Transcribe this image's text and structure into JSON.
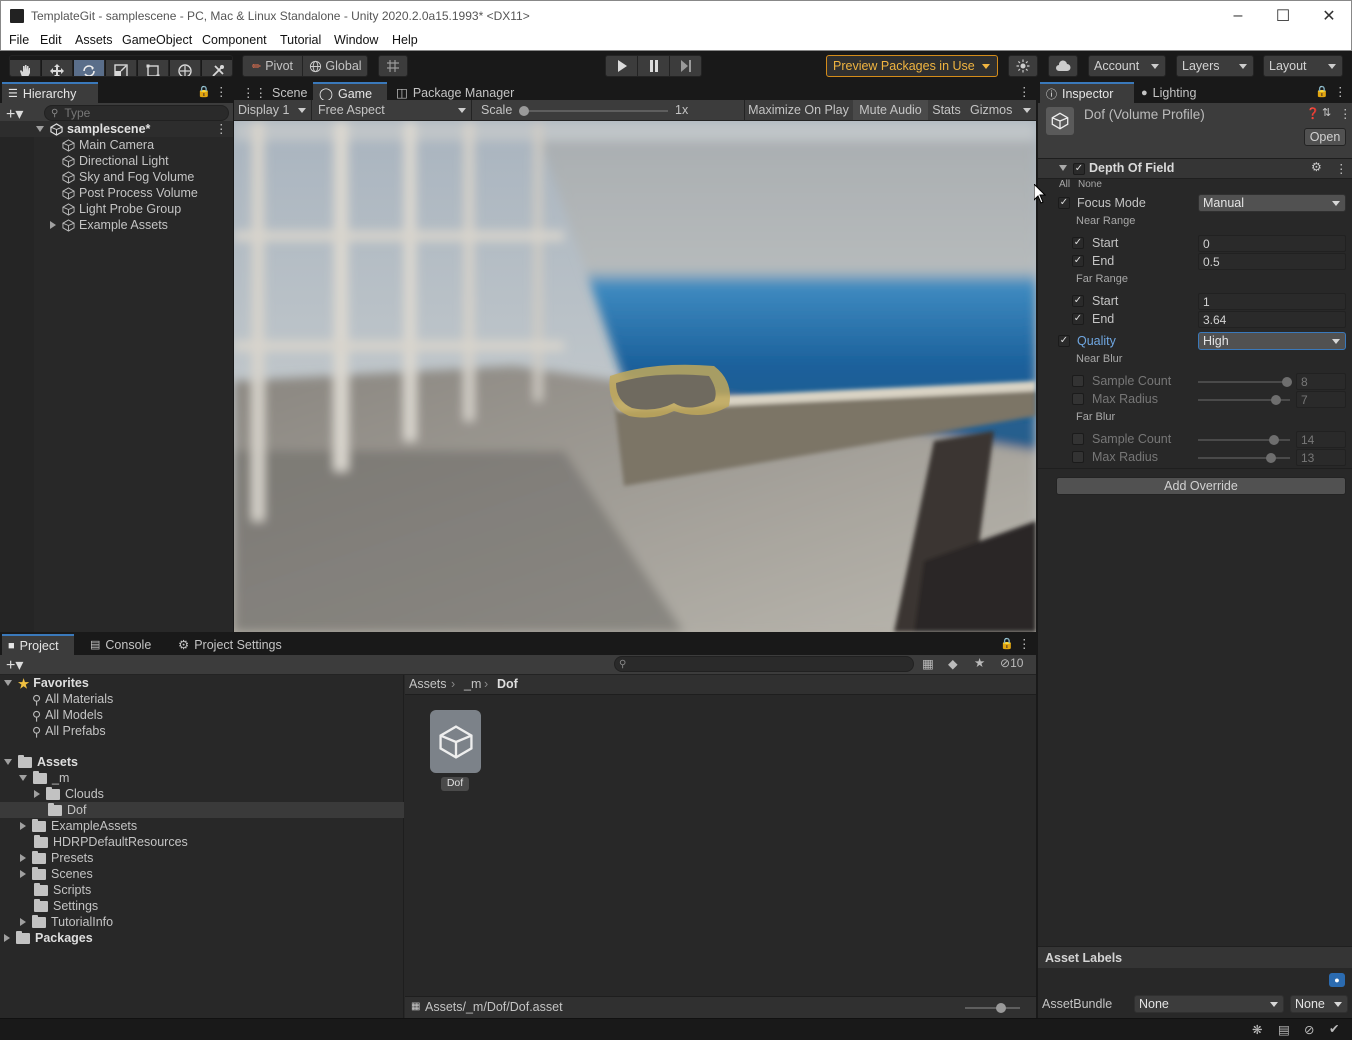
{
  "window": {
    "title": "TemplateGit - samplescene - PC, Mac & Linux Standalone - Unity 2020.2.0a15.1993* <DX11>"
  },
  "menu": [
    "File",
    "Edit",
    "Assets",
    "GameObject",
    "Component",
    "Tutorial",
    "Window",
    "Help"
  ],
  "toolbar": {
    "pivot_label": "Pivot",
    "global_label": "Global",
    "preview_packages": "Preview Packages in Use",
    "account": "Account",
    "layers": "Layers",
    "layout": "Layout"
  },
  "hierarchy": {
    "tab": "Hierarchy",
    "search_placeholder": "Type",
    "scene": "samplescene*",
    "items": [
      "Main Camera",
      "Directional Light",
      "Sky and Fog Volume",
      "Post Process Volume",
      "Light Probe Group",
      "Example Assets"
    ]
  },
  "center_tabs": {
    "scene": "Scene",
    "game": "Game",
    "package_manager": "Package Manager"
  },
  "game_bar": {
    "display": "Display 1",
    "aspect": "Free Aspect",
    "scale_label": "Scale",
    "scale_value": "1x",
    "scale_level": 0,
    "maximize": "Maximize On Play",
    "mute": "Mute Audio",
    "stats": "Stats",
    "gizmos": "Gizmos"
  },
  "inspector": {
    "tab": "Inspector",
    "lighting_tab": "Lighting",
    "asset_name": "Dof (Volume Profile)",
    "open_button": "Open",
    "component": "Depth Of Field",
    "all": "All",
    "none": "None",
    "focus_mode_label": "Focus Mode",
    "focus_mode_value": "Manual",
    "near_range": "Near Range",
    "near_start_label": "Start",
    "near_start": "0",
    "near_end_label": "End",
    "near_end": "0.5",
    "far_range": "Far Range",
    "far_start_label": "Start",
    "far_start": "1",
    "far_end_label": "End",
    "far_end": "3.64",
    "quality_label": "Quality",
    "quality_value": "High",
    "near_blur": "Near Blur",
    "near_sample_count_label": "Sample Count",
    "near_sample_count": "8",
    "near_max_radius_label": "Max Radius",
    "near_max_radius": "7",
    "far_blur": "Far Blur",
    "far_sample_count_label": "Sample Count",
    "far_sample_count": "14",
    "far_max_radius_label": "Max Radius",
    "far_max_radius": "13",
    "add_override": "Add Override",
    "asset_labels": "Asset Labels",
    "assetbundle_label": "AssetBundle",
    "assetbundle_value": "None",
    "assetbundle_variant": "None"
  },
  "project": {
    "tabs": {
      "project": "Project",
      "console": "Console",
      "settings": "Project Settings"
    },
    "hidden_count": "10",
    "favorites": "Favorites",
    "favorite_items": [
      "All Materials",
      "All Models",
      "All Prefabs"
    ],
    "assets": "Assets",
    "m_folder": "_m",
    "clouds": "Clouds",
    "dof": "Dof",
    "folders": [
      "ExampleAssets",
      "HDRPDefaultResources",
      "Presets",
      "Scenes",
      "Scripts",
      "Settings",
      "TutorialInfo"
    ],
    "packages": "Packages",
    "breadcrumb": [
      "Assets",
      "_m",
      "Dof"
    ],
    "asset_item": "Dof",
    "path": "Assets/_m/Dof/Dof.asset"
  },
  "colors": {
    "accent": "#3a79bb",
    "preview_border": "#d48c1a",
    "selection": "#3a3a3a"
  }
}
